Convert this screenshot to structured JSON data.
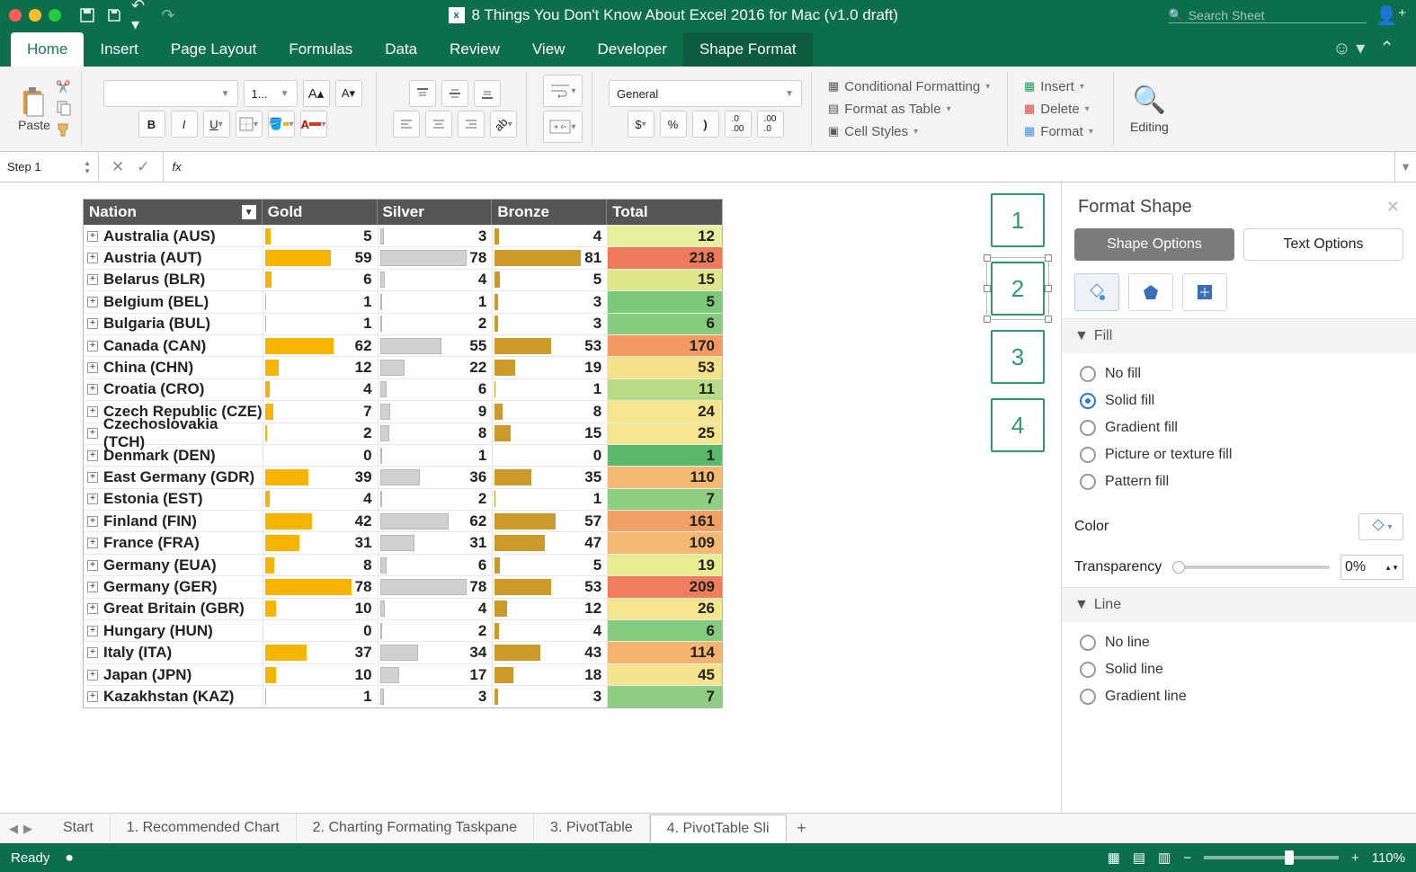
{
  "title": "8 Things You Don't Know About Excel 2016 for Mac (v1.0 draft)",
  "search_placeholder": "Search Sheet",
  "tabs": [
    "Home",
    "Insert",
    "Page Layout",
    "Formulas",
    "Data",
    "Review",
    "View",
    "Developer",
    "Shape Format"
  ],
  "active_tab": "Home",
  "ribbon": {
    "paste": "Paste",
    "font_name": " ",
    "font_size": "1...",
    "number_format": "General",
    "styles": {
      "cond": "Conditional Formatting",
      "table": "Format as Table",
      "cell": "Cell Styles"
    },
    "cells": {
      "insert": "Insert",
      "delete": "Delete",
      "format": "Format"
    },
    "editing": "Editing"
  },
  "namebox": "Step 1",
  "fx": "fx",
  "headers": {
    "nation": "Nation",
    "gold": "Gold",
    "silver": "Silver",
    "bronze": "Bronze",
    "total": "Total"
  },
  "rows": [
    {
      "n": "Australia (AUS)",
      "g": 5,
      "s": 3,
      "b": 4,
      "t": 12,
      "c": "#e8f0a0"
    },
    {
      "n": "Austria (AUT)",
      "g": 59,
      "s": 78,
      "b": 81,
      "t": 218,
      "c": "#ef7a5a"
    },
    {
      "n": "Belarus (BLR)",
      "g": 6,
      "s": 4,
      "b": 5,
      "t": 15,
      "c": "#dde88c"
    },
    {
      "n": "Belgium (BEL)",
      "g": 1,
      "s": 1,
      "b": 3,
      "t": 5,
      "c": "#7dc97a"
    },
    {
      "n": "Bulgaria (BUL)",
      "g": 1,
      "s": 2,
      "b": 3,
      "t": 6,
      "c": "#86cc7f"
    },
    {
      "n": "Canada (CAN)",
      "g": 62,
      "s": 55,
      "b": 53,
      "t": 170,
      "c": "#f29a62"
    },
    {
      "n": "China (CHN)",
      "g": 12,
      "s": 22,
      "b": 19,
      "t": 53,
      "c": "#f6e08a"
    },
    {
      "n": "Croatia (CRO)",
      "g": 4,
      "s": 6,
      "b": 1,
      "t": 11,
      "c": "#b8dd86"
    },
    {
      "n": "Czech Republic (CZE)",
      "g": 7,
      "s": 9,
      "b": 8,
      "t": 24,
      "c": "#f4e58e"
    },
    {
      "n": "Czechoslovakia (TCH)",
      "g": 2,
      "s": 8,
      "b": 15,
      "t": 25,
      "c": "#f4e58e"
    },
    {
      "n": "Denmark (DEN)",
      "g": 0,
      "s": 1,
      "b": 0,
      "t": 1,
      "c": "#5bb96e"
    },
    {
      "n": "East Germany (GDR)",
      "g": 39,
      "s": 36,
      "b": 35,
      "t": 110,
      "c": "#f3b872"
    },
    {
      "n": "Estonia (EST)",
      "g": 4,
      "s": 2,
      "b": 1,
      "t": 7,
      "c": "#8fce82"
    },
    {
      "n": "Finland (FIN)",
      "g": 42,
      "s": 62,
      "b": 57,
      "t": 161,
      "c": "#f1a166"
    },
    {
      "n": "France (FRA)",
      "g": 31,
      "s": 31,
      "b": 47,
      "t": 109,
      "c": "#f3b872"
    },
    {
      "n": "Germany (EUA)",
      "g": 8,
      "s": 6,
      "b": 5,
      "t": 19,
      "c": "#e8ec92"
    },
    {
      "n": "Germany (GER)",
      "g": 78,
      "s": 78,
      "b": 53,
      "t": 209,
      "c": "#ef7f5c"
    },
    {
      "n": "Great Britain (GBR)",
      "g": 10,
      "s": 4,
      "b": 12,
      "t": 26,
      "c": "#f4e58e"
    },
    {
      "n": "Hungary (HUN)",
      "g": 0,
      "s": 2,
      "b": 4,
      "t": 6,
      "c": "#86cc7f"
    },
    {
      "n": "Italy (ITA)",
      "g": 37,
      "s": 34,
      "b": 43,
      "t": 114,
      "c": "#f3b470"
    },
    {
      "n": "Japan (JPN)",
      "g": 10,
      "s": 17,
      "b": 18,
      "t": 45,
      "c": "#f5e48e"
    },
    {
      "n": "Kazakhstan (KAZ)",
      "g": 1,
      "s": 3,
      "b": 3,
      "t": 7,
      "c": "#8fce82"
    }
  ],
  "max": {
    "g": 78,
    "s": 78,
    "b": 81
  },
  "slicers": [
    "1",
    "2",
    "3",
    "4"
  ],
  "format_shape": {
    "title": "Format Shape",
    "tab_shape": "Shape Options",
    "tab_text": "Text Options",
    "fill_head": "Fill",
    "fill_opts": [
      "No fill",
      "Solid fill",
      "Gradient fill",
      "Picture or texture fill",
      "Pattern fill"
    ],
    "fill_selected": 1,
    "color_label": "Color",
    "transp_label": "Transparency",
    "transp_value": "0%",
    "line_head": "Line",
    "line_opts": [
      "No line",
      "Solid line",
      "Gradient line"
    ]
  },
  "sheet_tabs": [
    "Start",
    "1. Recommended Chart",
    "2. Charting Formating Taskpane",
    "3. PivotTable",
    "4. PivotTable Sli"
  ],
  "active_sheet": 4,
  "status": "Ready",
  "zoom": "110%"
}
